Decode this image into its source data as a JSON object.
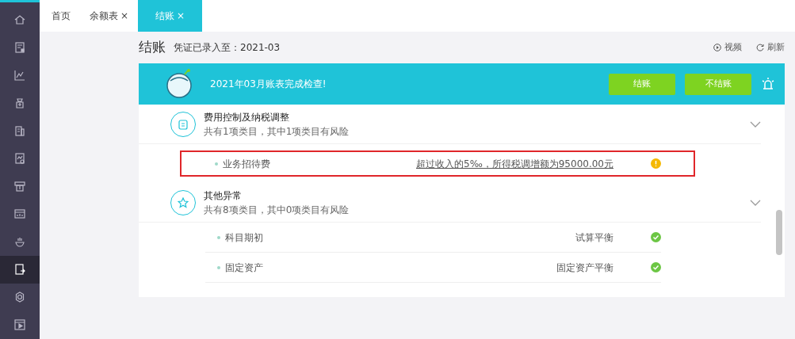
{
  "sidebar": {
    "items": [
      {
        "selected": false
      },
      {
        "selected": false
      },
      {
        "selected": false
      },
      {
        "selected": false
      },
      {
        "selected": false
      },
      {
        "selected": false
      },
      {
        "selected": false
      },
      {
        "selected": false
      },
      {
        "selected": false
      },
      {
        "selected": true
      },
      {
        "selected": false
      },
      {
        "selected": false
      }
    ]
  },
  "tabs": [
    {
      "label": "首页",
      "selected": false
    },
    {
      "label": "余额表",
      "close": "×",
      "selected": false
    },
    {
      "label": "结账",
      "close": "×",
      "selected": true
    }
  ],
  "header": {
    "title": "结账",
    "subtitle": "凭证已录入至：2021-03",
    "actions": [
      {
        "label": "视频"
      },
      {
        "label": "刷新"
      }
    ]
  },
  "banner": {
    "message": "2021年03月账表完成检查!",
    "buttons": [
      "结账",
      "不结账"
    ]
  },
  "sections": [
    {
      "title": "费用控制及纳税调整",
      "summary": "共有1项类目，其中1项类目有风险",
      "expanded": true,
      "items": [
        {
          "name": "业务招待费",
          "result": "超过收入的5‰，所得税调增额为95000.00元",
          "risk": true,
          "highlighted": true
        }
      ]
    },
    {
      "title": "其他异常",
      "summary": "共有8项类目，其中0项类目有风险",
      "expanded": true,
      "items": [
        {
          "name": "科目期初",
          "result": "试算平衡",
          "risk": false,
          "highlighted": false
        },
        {
          "name": "固定资产",
          "result": "固定资产平衡",
          "risk": false,
          "highlighted": false
        }
      ]
    }
  ]
}
